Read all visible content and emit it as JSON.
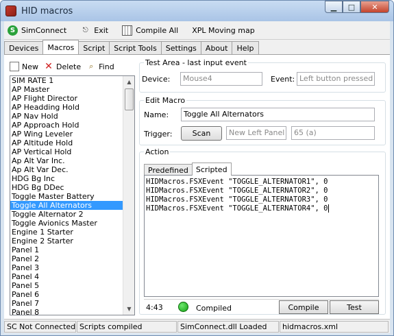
{
  "window": {
    "title": "HID macros"
  },
  "toolbar": {
    "simconnect": "SimConnect",
    "exit": "Exit",
    "compile_all": "Compile All",
    "xpl": "XPL Moving map"
  },
  "tabs": [
    "Devices",
    "Macros",
    "Script",
    "Script Tools",
    "Settings",
    "About",
    "Help"
  ],
  "active_tab": "Macros",
  "macro_toolbar": {
    "new": "New",
    "delete": "Delete",
    "find": "Find"
  },
  "macros": [
    "SIM RATE 1",
    "AP Master",
    "AP Flight Director",
    "AP Headding Hold",
    "AP Nav Hold",
    "AP Approach Hold",
    "AP Wing Leveler",
    "AP Altitude Hold",
    "AP Vertical Hold",
    "Ap Alt Var Inc.",
    "Ap Alt Var Dec.",
    "HDG Bg Inc",
    "HDG Bg DDec",
    "Toggle Master Battery",
    "Toggle All Alternators",
    "Toggle Alternator 2",
    "Toggle Avionics Master",
    "Engine 1 Starter",
    "Engine 2 Starter",
    "Panel 1",
    "Panel 2",
    "Panel 3",
    "Panel 4",
    "Panel 5",
    "Panel 6",
    "Panel 7",
    "Panel 8"
  ],
  "selected_macro_index": 14,
  "test_area": {
    "title": "Test Area - last input event",
    "device_label": "Device:",
    "device_value": "Mouse4",
    "event_label": "Event:",
    "event_value": "Left button pressed"
  },
  "edit_macro": {
    "title": "Edit Macro",
    "name_label": "Name:",
    "name_value": "Toggle All Alternators",
    "trigger_label": "Trigger:",
    "scan_button": "Scan",
    "trigger_device": "New Left Panel",
    "trigger_key": "65  (a)"
  },
  "action": {
    "title": "Action",
    "tabs": [
      "Predefined",
      "Scripted"
    ],
    "active_tab": "Scripted",
    "script_lines": [
      "HIDMacros.FSXEvent \"TOGGLE_ALTERNATOR1\", 0",
      "HIDMacros.FSXEvent \"TOGGLE_ALTERNATOR2\", 0",
      "HIDMacros.FSXEvent \"TOGGLE_ALTERNATOR3\", 0",
      "HIDMacros.FSXEvent \"TOGGLE_ALTERNATOR4\", 0"
    ],
    "cursor_pos": "4:43",
    "compile_status": "Compiled",
    "status_color": "#14a214",
    "compile_button": "Compile",
    "test_button": "Test"
  },
  "statusbar": {
    "sc": "SC Not Connected",
    "scripts": "Scripts compiled",
    "dll": "SimConnect.dll Loaded",
    "file": "hidmacros.xml"
  }
}
